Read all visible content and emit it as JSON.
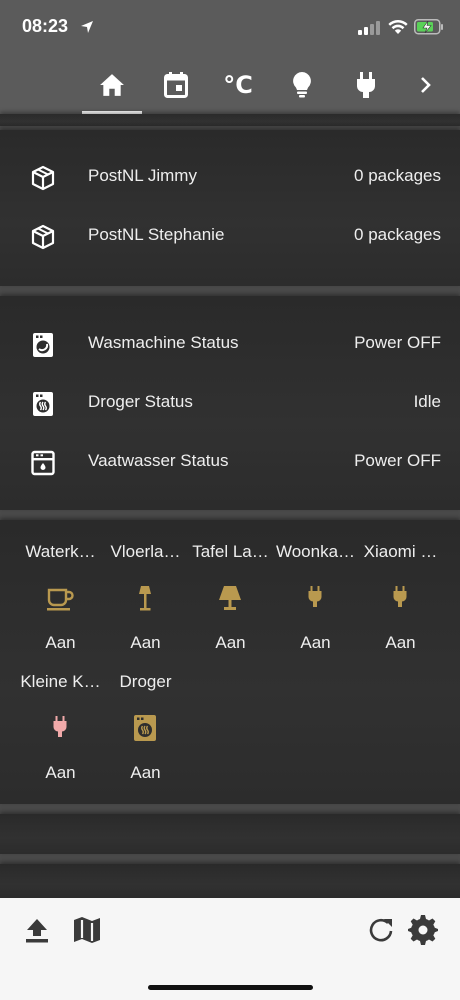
{
  "status_bar": {
    "time": "08:23"
  },
  "tabs": [
    {
      "icon": "home-icon",
      "active": true
    },
    {
      "icon": "calendar-icon"
    },
    {
      "icon": "temperature-icon",
      "label": "°C"
    },
    {
      "icon": "lightbulb-icon"
    },
    {
      "icon": "power-plug-icon"
    },
    {
      "icon": "chevron-right-icon"
    }
  ],
  "packages": [
    {
      "icon": "package-icon",
      "name": "PostNL Jimmy",
      "value": "0 packages"
    },
    {
      "icon": "package-icon",
      "name": "PostNL Stephanie",
      "value": "0 packages"
    }
  ],
  "appliances": [
    {
      "icon": "washing-machine-icon",
      "name": "Wasmachine Status",
      "value": "Power OFF"
    },
    {
      "icon": "tumble-dryer-icon",
      "name": "Droger Status",
      "value": "Idle"
    },
    {
      "icon": "dishwasher-icon",
      "name": "Vaatwasser Status",
      "value": "Power OFF"
    }
  ],
  "tiles": [
    {
      "name": "Waterk…",
      "icon": "kettle-cup-icon",
      "state": "Aan",
      "color": "#b9994f"
    },
    {
      "name": "Vloerla…",
      "icon": "floor-lamp-icon",
      "state": "Aan",
      "color": "#b9994f"
    },
    {
      "name": "Tafel La…",
      "icon": "table-lamp-icon",
      "state": "Aan",
      "color": "#b9994f"
    },
    {
      "name": "Woonka…",
      "icon": "power-plug-icon",
      "state": "Aan",
      "color": "#b9994f"
    },
    {
      "name": "Xiaomi …",
      "icon": "power-plug-icon",
      "state": "Aan",
      "color": "#b9994f"
    },
    {
      "name": "Kleine K…",
      "icon": "power-plug-icon",
      "state": "Aan",
      "color": "#f0a9a9"
    },
    {
      "name": "Droger",
      "icon": "tumble-dryer-icon",
      "state": "Aan",
      "color": "#b9994f"
    }
  ],
  "bottom_toolbar": [
    {
      "icon": "upload-icon"
    },
    {
      "icon": "map-icon"
    },
    {
      "icon": "refresh-icon"
    },
    {
      "icon": "settings-gear-icon"
    }
  ]
}
